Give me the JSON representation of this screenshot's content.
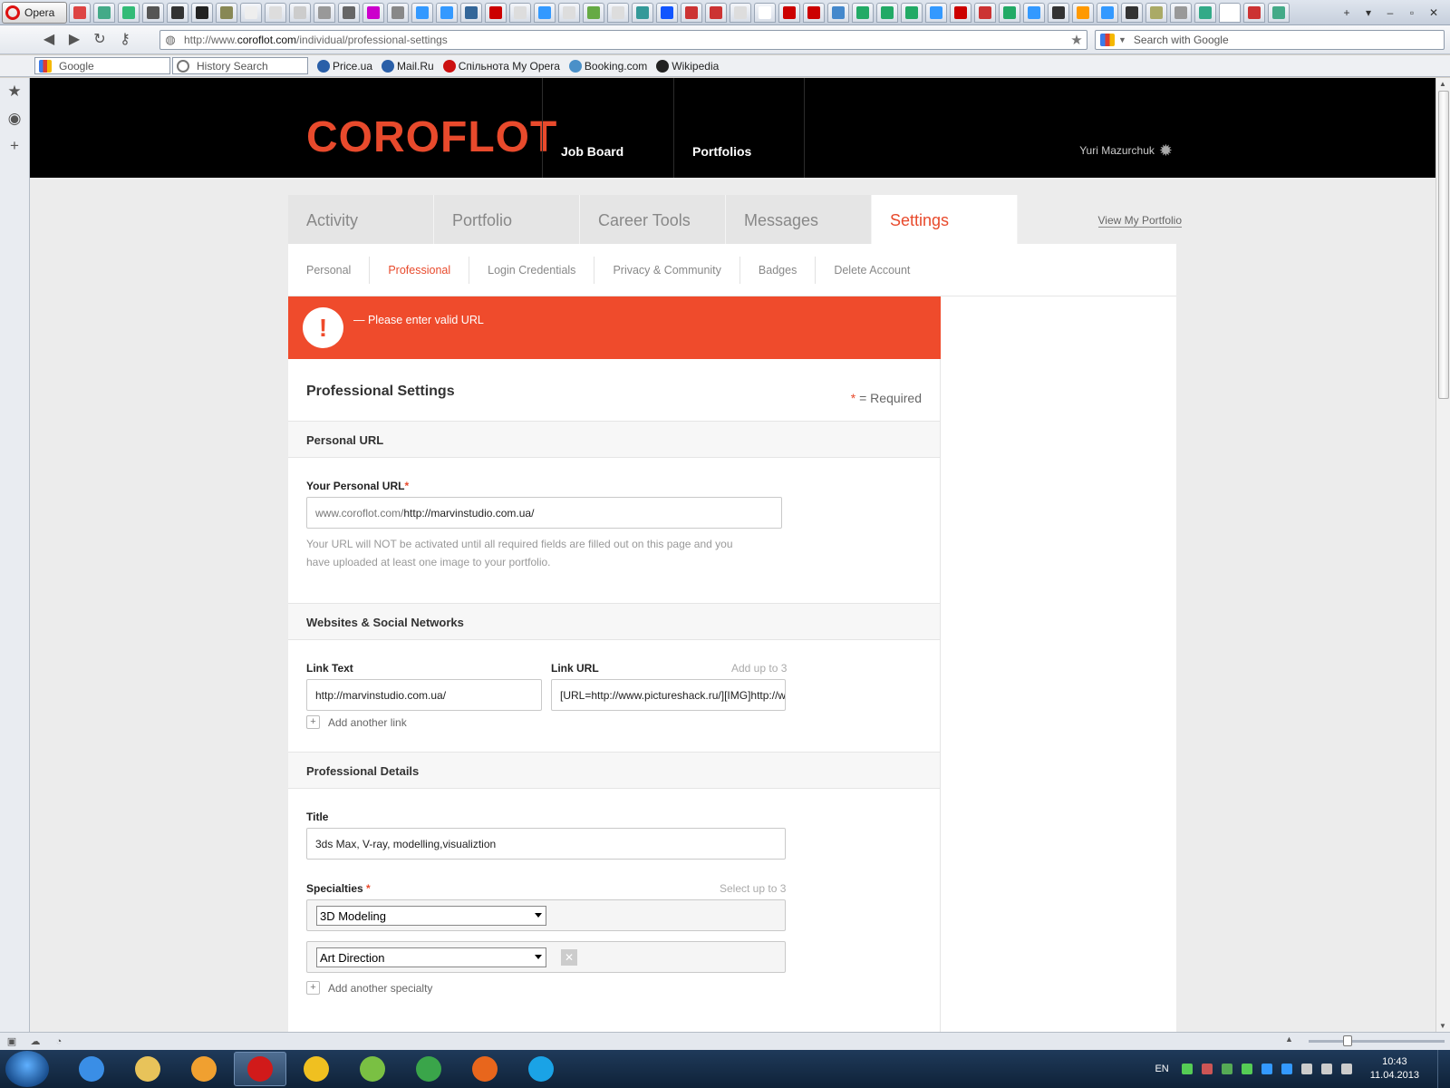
{
  "browser": {
    "menu_label": "Opera",
    "tab_colors": [
      "#d44",
      "#4a8",
      "#3b7",
      "#555",
      "#333",
      "#222",
      "#885",
      "#eee",
      "#ddd",
      "#ccc",
      "#999",
      "#666",
      "#c0c",
      "#888",
      "#39f",
      "#39f",
      "#369",
      "#c00",
      "#ddd",
      "#39f",
      "#ddd",
      "#6a4",
      "#ddd",
      "#399",
      "#15f",
      "#c33",
      "#c33",
      "#ddd",
      "#fff",
      "#c00",
      "#c00",
      "#48c",
      "#2a6",
      "#2a6",
      "#2a6",
      "#39f",
      "#c00",
      "#c33",
      "#2a6",
      "#39f",
      "#333",
      "#f90",
      "#39f",
      "#333",
      "#aa6",
      "#999",
      "#3a8",
      "#fff",
      "#c33",
      "#4a8"
    ],
    "address": {
      "prefix": "http://www.",
      "domain": "coroflot.com",
      "path": "/individual/professional-settings"
    },
    "search_placeholder": "Search with Google",
    "bookmarks": {
      "google_field": "Google",
      "history_field": "History Search",
      "links": [
        {
          "label": "Price.ua",
          "color": "#2a5fa8"
        },
        {
          "label": "Mail.Ru",
          "color": "#2a5fa8"
        },
        {
          "label": "Спільнота My Opera",
          "color": "#cc1111"
        },
        {
          "label": "Booking.com",
          "color": "#4a90c8"
        },
        {
          "label": "Wikipedia",
          "color": "#222222"
        }
      ]
    }
  },
  "site": {
    "logo": "COROFLOT",
    "nav": {
      "job_board": "Job Board",
      "portfolios": "Portfolios"
    },
    "user_name": "Yuri Mazurchuk",
    "accent_color": "#e84a2c"
  },
  "main_tabs": [
    {
      "label": "Activity"
    },
    {
      "label": "Portfolio"
    },
    {
      "label": "Career Tools"
    },
    {
      "label": "Messages"
    },
    {
      "label": "Settings"
    }
  ],
  "view_portfolio_label": "View My Portfolio",
  "sub_tabs": [
    {
      "label": "Personal"
    },
    {
      "label": "Professional"
    },
    {
      "label": "Login Credentials"
    },
    {
      "label": "Privacy & Community"
    },
    {
      "label": "Badges"
    },
    {
      "label": "Delete Account"
    }
  ],
  "error": {
    "icon": "!",
    "message": "— Please enter valid URL"
  },
  "form": {
    "title": "Professional Settings",
    "required_star": "*",
    "required_note": " = Required",
    "personal_url": {
      "section_title": "Personal URL",
      "label": "Your Personal URL",
      "prefix": "www.coroflot.com/",
      "value": "http://marvinstudio.com.ua/",
      "help_line1": "Your URL will NOT be activated until all required fields are filled out on this page and you",
      "help_line2": "have uploaded at least one image to your portfolio."
    },
    "websites": {
      "section_title": "Websites & Social Networks",
      "link_text_label": "Link Text",
      "link_url_label": "Link URL",
      "limit_hint": "Add up to 3",
      "link_text_value": "http://marvinstudio.com.ua/",
      "link_url_value": "[URL=http://www.pictureshack.ru/][IMG]http://w",
      "add_label": "Add another link"
    },
    "details": {
      "section_title": "Professional Details",
      "title_label": "Title",
      "title_value": "3ds Max, V-ray, modelling,visualiztion",
      "specialties_label": "Specialties",
      "specialties_hint": "Select up to 3",
      "specialty_1": "3D Modeling",
      "specialty_2": "Art Direction",
      "remove_glyph": "✕",
      "add_label": "Add another specialty"
    }
  },
  "taskbar": {
    "apps": [
      {
        "name": "ie",
        "color": "#3a8ee6"
      },
      {
        "name": "explorer",
        "color": "#e8c35a"
      },
      {
        "name": "media-player",
        "color": "#f0a030"
      },
      {
        "name": "opera",
        "color": "#d11a1a"
      },
      {
        "name": "lightning-app",
        "color": "#f0c020"
      },
      {
        "name": "app-green",
        "color": "#7ac043"
      },
      {
        "name": "utorrent",
        "color": "#3aa54a"
      },
      {
        "name": "firefox",
        "color": "#e8661c"
      },
      {
        "name": "skype",
        "color": "#1aa3e6"
      }
    ],
    "active_app": 3,
    "language": "EN",
    "tray_colors": [
      "#5c5",
      "#c55",
      "#5a5",
      "#5c5",
      "#39f",
      "#39f",
      "#ccc",
      "#ccc",
      "#ccc"
    ],
    "time": "10:43",
    "date": "11.04.2013"
  }
}
